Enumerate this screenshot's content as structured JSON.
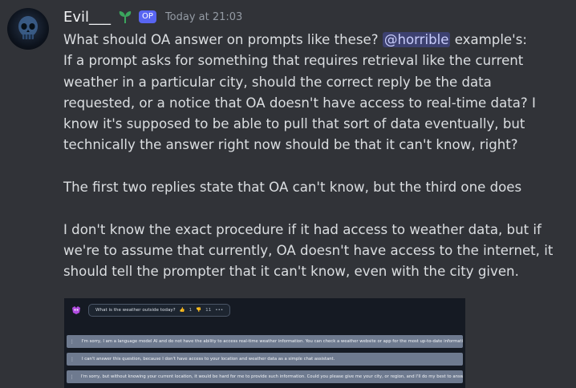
{
  "author": {
    "name": "Evil___",
    "badge": "OP",
    "timestamp": "Today at 21:03"
  },
  "message": {
    "line1_before": "What should OA answer on prompts like these? ",
    "mention": "@horrible",
    "line1_after": " example's:",
    "paragraph1": [
      "If a prompt asks for something that requires retrieval like the current",
      "weather in a particular city, should the correct reply be the data",
      "requested, or a notice that OA doesn't have access to real-time data? I",
      "know it's supposed to be able to pull that sort of data eventually, but",
      "technically the answer right now should be that it can't know, right?"
    ],
    "paragraph2": "The first two replies state that OA can't know, but the third one does",
    "paragraph3": [
      "I don't know the exact procedure if it had access to weather data, but if",
      "we're to assume that currently, OA doesn't have access to the internet, it",
      "should tell the prompter that it can't know, even with the city given."
    ]
  },
  "embed": {
    "prompt": "What is the weather outside today?",
    "likes": "1",
    "dislikes": "11",
    "more": "•••",
    "replies": [
      "I'm sorry, I am a language model AI and do not have the ability to access real-time weather information. You can check a weather website or app for the most up-to-date information.",
      "I can't answer this question, because I don't have access to your location and weather data as a simple chat assistant.",
      "I'm sorry, but without knowing your current location, it would be hard for me to provide such information. Could you please give me your city, or region, and I'll do my best to answer that for you!"
    ]
  },
  "colors": {
    "background": "#313338",
    "text": "#dbdee1",
    "username": "#f2f3f5",
    "timestamp": "#949ba4",
    "op_badge": "#5865f2",
    "sprout": "#3ba55d",
    "embed_background": "#151a23",
    "reply_background": "#6e7a8f"
  },
  "icons": {
    "avatar": "blue-skull-avatar",
    "sprout": "sprout-icon",
    "bot": "purple-bot-icon",
    "grip": "drag-handle-icon"
  }
}
